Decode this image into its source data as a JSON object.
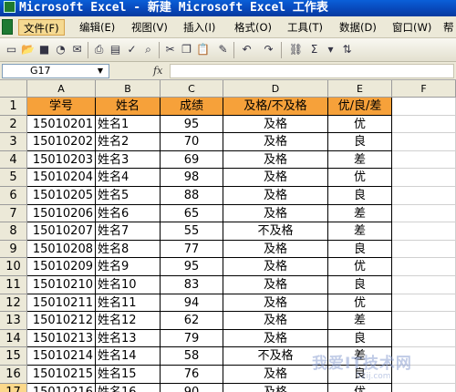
{
  "window": {
    "title": "Microsoft Excel - 新建 Microsoft Excel 工作表"
  },
  "menu": {
    "items": [
      "文件(F)",
      "编辑(E)",
      "视图(V)",
      "插入(I)",
      "格式(O)",
      "工具(T)",
      "数据(D)",
      "窗口(W)",
      "帮"
    ]
  },
  "toolbar": {
    "icons": [
      "new-icon",
      "open-icon",
      "save-icon",
      "permission-icon",
      "email-icon",
      "print-icon",
      "print-preview-icon",
      "spelling-icon",
      "research-icon",
      "cut-icon",
      "copy-icon",
      "paste-icon",
      "format-painter-icon",
      "undo-icon",
      "redo-icon",
      "hyperlink-icon",
      "autosum-icon",
      "sort-ascending-icon"
    ]
  },
  "formula_bar": {
    "name_box": "G17",
    "fx": "fx",
    "formula": ""
  },
  "columns": [
    "A",
    "B",
    "C",
    "D",
    "E",
    "F"
  ],
  "header_row": {
    "num": "1",
    "cells": [
      "学号",
      "姓名",
      "成绩",
      "及格/不及格",
      "优/良/差"
    ]
  },
  "rows": [
    {
      "num": "2",
      "cells": [
        "15010201",
        "姓名1",
        "95",
        "及格",
        "优"
      ]
    },
    {
      "num": "3",
      "cells": [
        "15010202",
        "姓名2",
        "70",
        "及格",
        "良"
      ]
    },
    {
      "num": "4",
      "cells": [
        "15010203",
        "姓名3",
        "69",
        "及格",
        "差"
      ]
    },
    {
      "num": "5",
      "cells": [
        "15010204",
        "姓名4",
        "98",
        "及格",
        "优"
      ]
    },
    {
      "num": "6",
      "cells": [
        "15010205",
        "姓名5",
        "88",
        "及格",
        "良"
      ]
    },
    {
      "num": "7",
      "cells": [
        "15010206",
        "姓名6",
        "65",
        "及格",
        "差"
      ]
    },
    {
      "num": "8",
      "cells": [
        "15010207",
        "姓名7",
        "55",
        "不及格",
        "差"
      ]
    },
    {
      "num": "9",
      "cells": [
        "15010208",
        "姓名8",
        "77",
        "及格",
        "良"
      ]
    },
    {
      "num": "10",
      "cells": [
        "15010209",
        "姓名9",
        "95",
        "及格",
        "优"
      ]
    },
    {
      "num": "11",
      "cells": [
        "15010210",
        "姓名10",
        "83",
        "及格",
        "良"
      ]
    },
    {
      "num": "12",
      "cells": [
        "15010211",
        "姓名11",
        "94",
        "及格",
        "优"
      ]
    },
    {
      "num": "13",
      "cells": [
        "15010212",
        "姓名12",
        "62",
        "及格",
        "差"
      ]
    },
    {
      "num": "14",
      "cells": [
        "15010213",
        "姓名13",
        "79",
        "及格",
        "良"
      ]
    },
    {
      "num": "15",
      "cells": [
        "15010214",
        "姓名14",
        "58",
        "不及格",
        "差"
      ]
    },
    {
      "num": "16",
      "cells": [
        "15010215",
        "姓名15",
        "76",
        "及格",
        "良"
      ]
    },
    {
      "num": "17",
      "cells": [
        "15010216",
        "姓名16",
        "90",
        "及格",
        "优"
      ]
    }
  ],
  "active_row": "17",
  "watermark": {
    "text": "我爱IT技术网",
    "sub": "52ij.com"
  }
}
